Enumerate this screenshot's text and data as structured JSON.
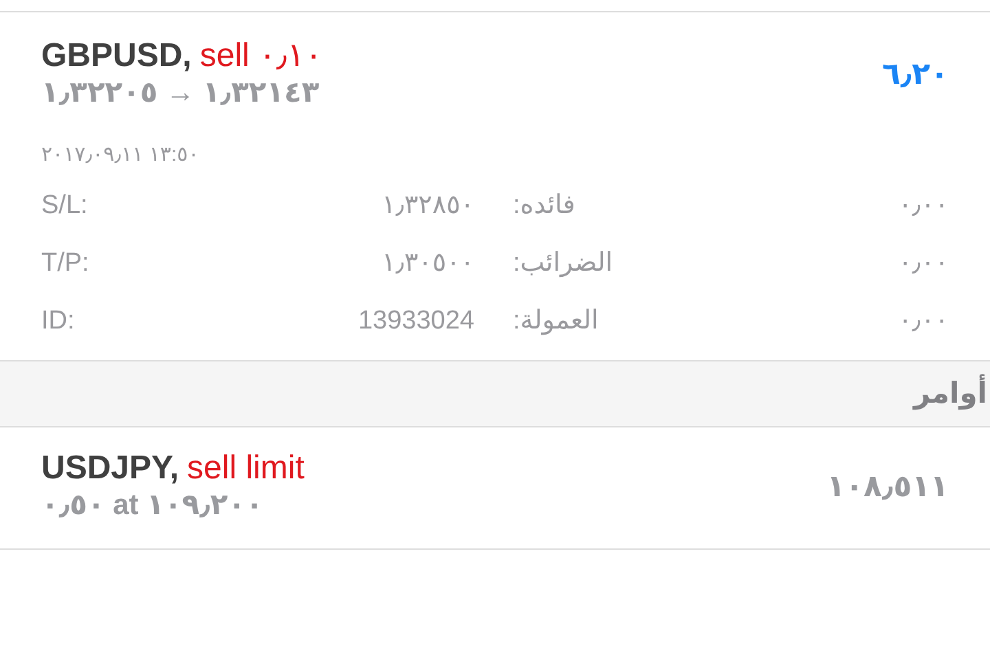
{
  "positions": [
    {
      "symbol": "GBPUSD,",
      "trade": "sell ٠٫١٠",
      "prices": "١٫٣٢١٤٣ → ١٫٣٢٢٠٥",
      "profit": "٦٫٢٠",
      "time": "١٣:٥٠ ٢٠١٧٫٠٩٫١١",
      "details": [
        {
          "label": "S/L:",
          "value": "١٫٣٢٨٥٠",
          "label_2": "فائده:",
          "value_2": "٠٫٠٠"
        },
        {
          "label": "T/P:",
          "value": "١٫٣٠٥٠٠",
          "label_2": "الضرائب:",
          "value_2": "٠٫٠٠"
        },
        {
          "label": "ID:",
          "value": "13933024",
          "label_2": "العمولة:",
          "value_2": "٠٫٠٠"
        }
      ]
    }
  ],
  "orders_header": "أوامر",
  "orders": [
    {
      "symbol": "USDJPY,",
      "trade": "sell limit",
      "volume_price": "٠٫٥٠ at ١٠٩٫٢٠٠",
      "price": "١٠٨٫٥١١"
    }
  ]
}
